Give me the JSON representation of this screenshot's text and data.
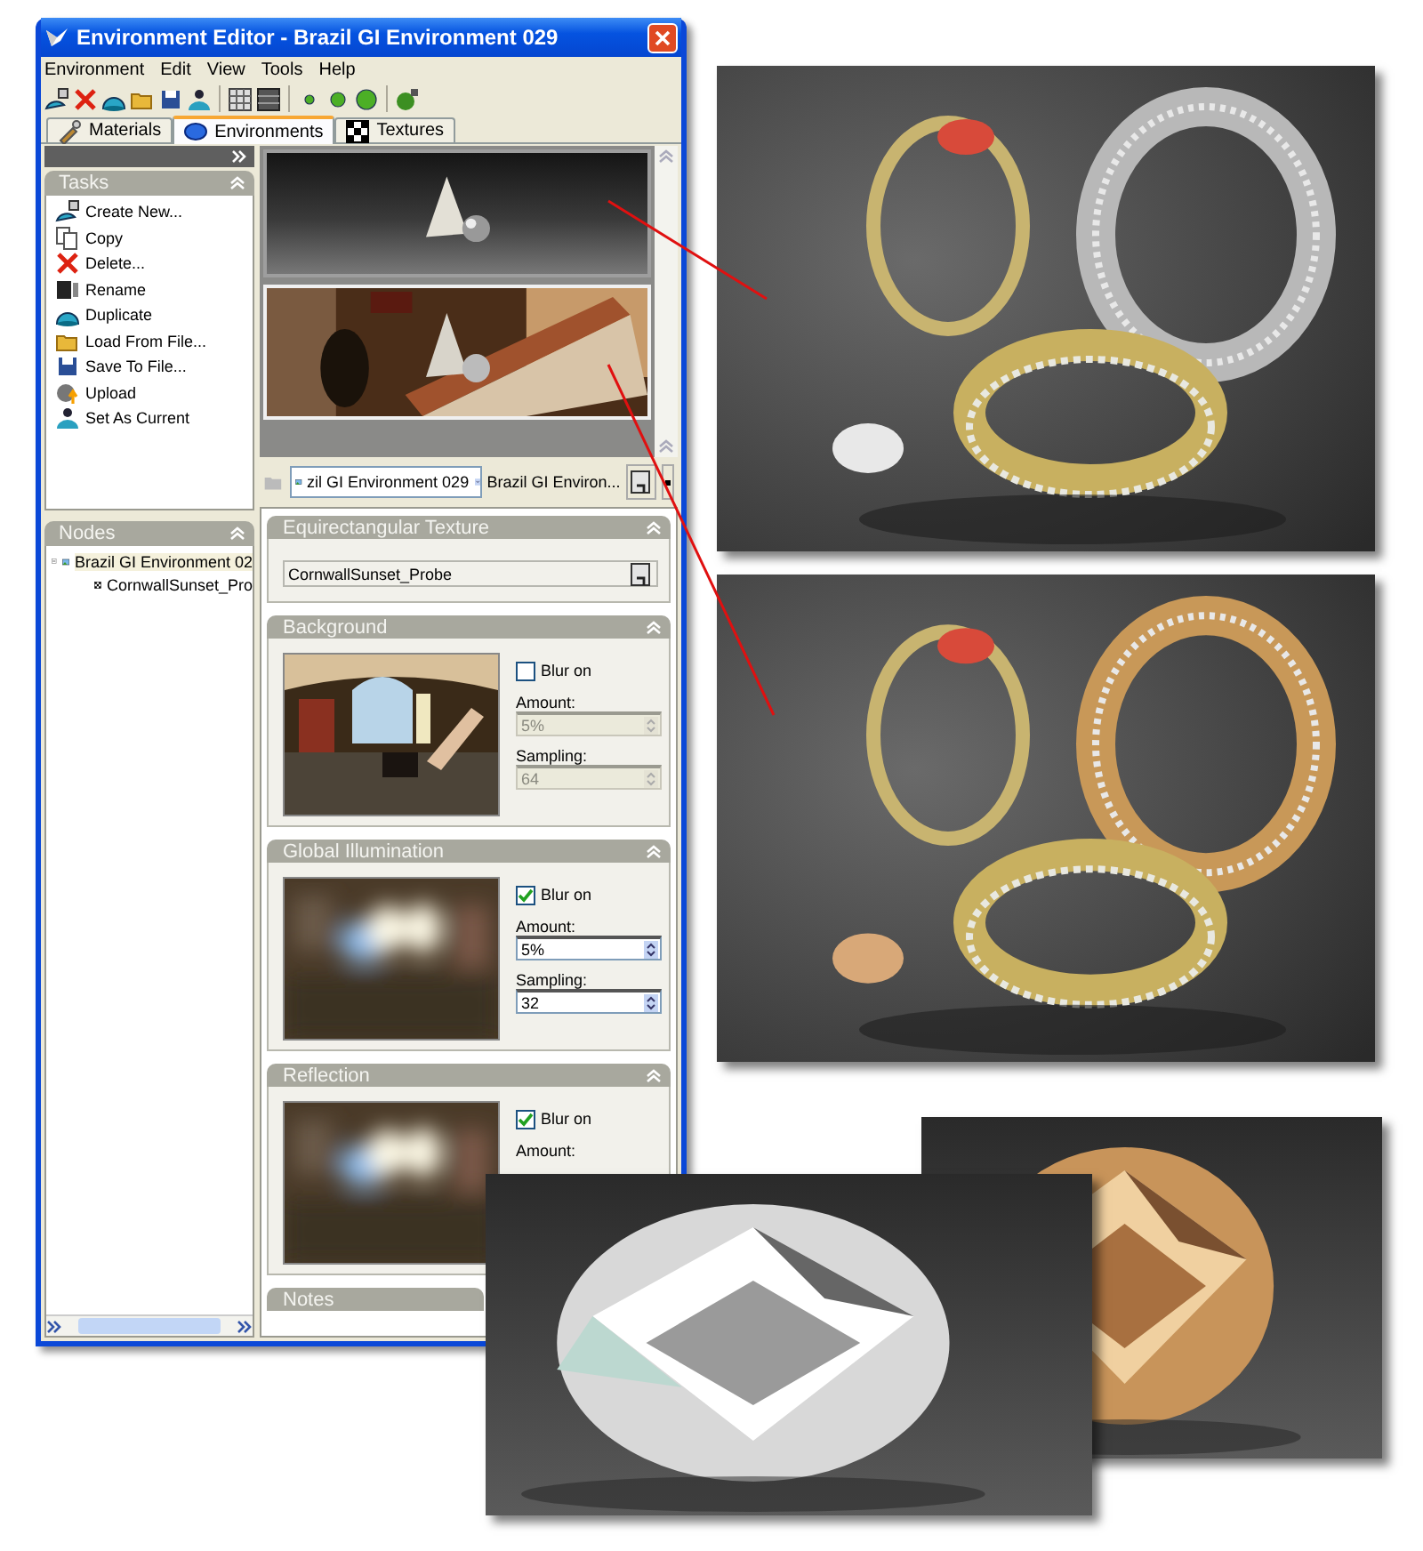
{
  "window": {
    "title": "Environment Editor - Brazil GI Environment 029"
  },
  "menu": [
    "Environment",
    "Edit",
    "View",
    "Tools",
    "Help"
  ],
  "tabs": [
    {
      "label": "Materials",
      "selected": false
    },
    {
      "label": "Environments",
      "selected": true
    },
    {
      "label": "Textures",
      "selected": false
    }
  ],
  "tasks": {
    "title": "Tasks",
    "items": [
      "Create New...",
      "Copy",
      "Delete...",
      "Rename",
      "Duplicate",
      "Load From File...",
      "Save To File...",
      "Upload",
      "Set As Current"
    ]
  },
  "nodes": {
    "title": "Nodes",
    "tree": [
      {
        "label": "Brazil GI Environment 02",
        "expanded": true,
        "children": [
          {
            "label": "CornwallSunset_Pro"
          }
        ]
      }
    ]
  },
  "selector": {
    "environment": "zil GI Environment 029",
    "name": "Brazil GI Environ..."
  },
  "sections": [
    {
      "title": "Equirectangular Texture",
      "kind": "texture",
      "value": "CornwallSunset_Probe"
    },
    {
      "title": "Background",
      "kind": "map",
      "blur": {
        "label": "Blur on",
        "checked": false
      },
      "disabled": true,
      "fields": [
        {
          "label": "Amount:",
          "value": "5%"
        },
        {
          "label": "Sampling:",
          "value": "64"
        }
      ]
    },
    {
      "title": "Global Illumination",
      "kind": "map",
      "blur": {
        "label": "Blur on",
        "checked": true
      },
      "disabled": false,
      "fields": [
        {
          "label": "Amount:",
          "value": "5%"
        },
        {
          "label": "Sampling:",
          "value": "32"
        }
      ]
    },
    {
      "title": "Reflection",
      "kind": "map",
      "blur": {
        "label": "Blur on",
        "checked": true
      },
      "fields": [
        {
          "label": "Amount:"
        }
      ]
    },
    {
      "title": "Notes",
      "kind": "collapsed"
    }
  ]
}
